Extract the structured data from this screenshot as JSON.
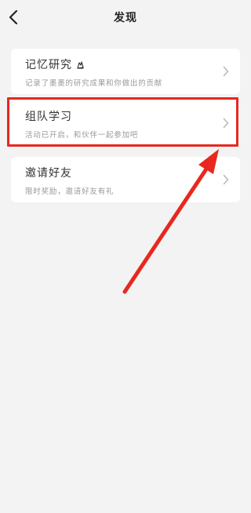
{
  "nav": {
    "title": "发现",
    "back_icon": "chevron-left-icon"
  },
  "cards": [
    {
      "title": "记忆研究",
      "title_icon": "sparkle-hand-icon",
      "subtitle": "记录了墨墨的研究成果和你做出的贡献",
      "chevron_icon": "chevron-right-icon"
    },
    {
      "title": "组队学习",
      "subtitle": "活动已开启，和伙伴一起参加吧",
      "chevron_icon": "chevron-right-icon"
    },
    {
      "title": "邀请好友",
      "subtitle": "限时奖励，邀请好友有礼",
      "chevron_icon": "chevron-right-icon"
    }
  ],
  "annotation": {
    "color": "#e8281e",
    "highlighted_item": "组队学习"
  },
  "colors": {
    "background": "#f3f3f4",
    "card": "#ffffff",
    "title_text": "#333333",
    "subtitle_text": "#999999"
  }
}
